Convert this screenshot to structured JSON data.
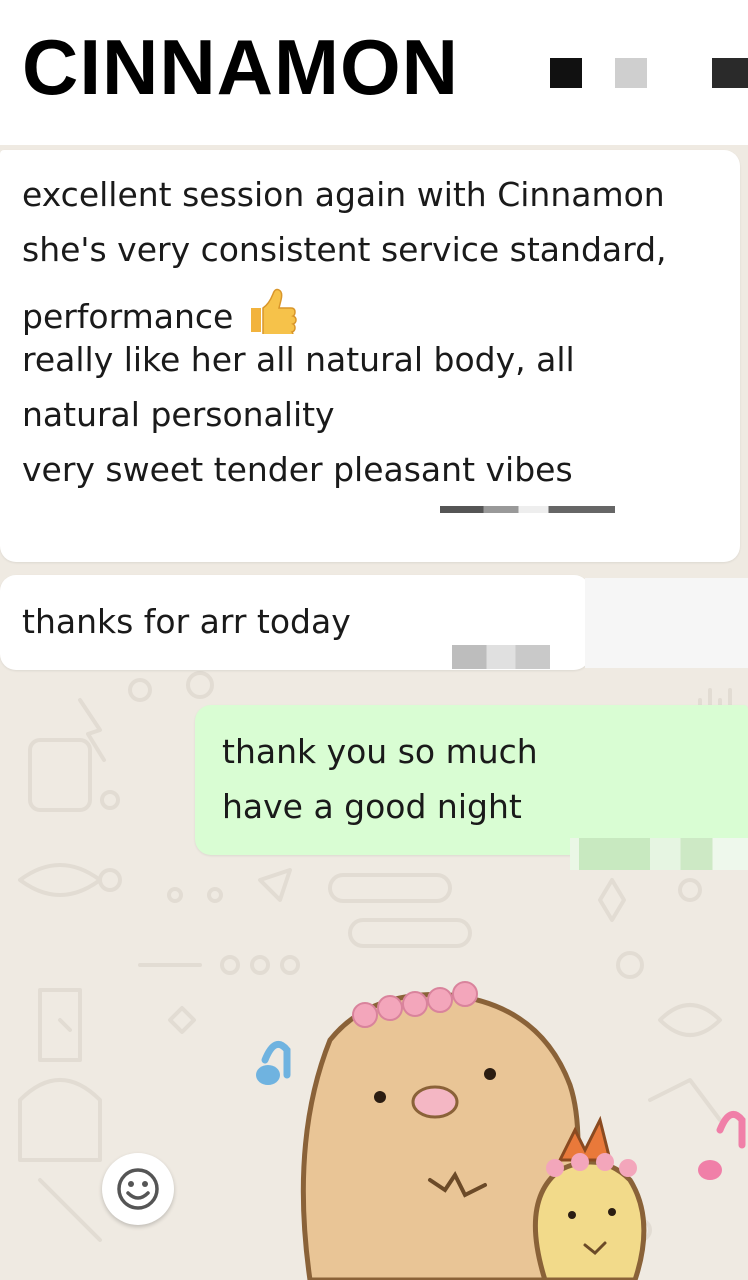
{
  "header": {
    "title": "CINNAMON"
  },
  "messages": [
    {
      "direction": "incoming",
      "lines": [
        "excellent session again with Cinnamon",
        "she's very consistent service standard,",
        "performance",
        "really like her all natural body, all",
        "natural personality",
        "very sweet tender pleasant vibes"
      ],
      "emoji": "thumbs-up-icon"
    },
    {
      "direction": "incoming",
      "lines": [
        "thanks for arr today"
      ]
    },
    {
      "direction": "outgoing",
      "lines": [
        "thank you so much",
        "have a good night"
      ]
    }
  ],
  "sticker": {
    "icon": "sticker-character-icon"
  },
  "controls": {
    "emoji_button_icon": "smiley-icon"
  },
  "colors": {
    "chat_background": "#efeae2",
    "incoming_bubble": "#ffffff",
    "outgoing_bubble": "#d9fdd3"
  }
}
